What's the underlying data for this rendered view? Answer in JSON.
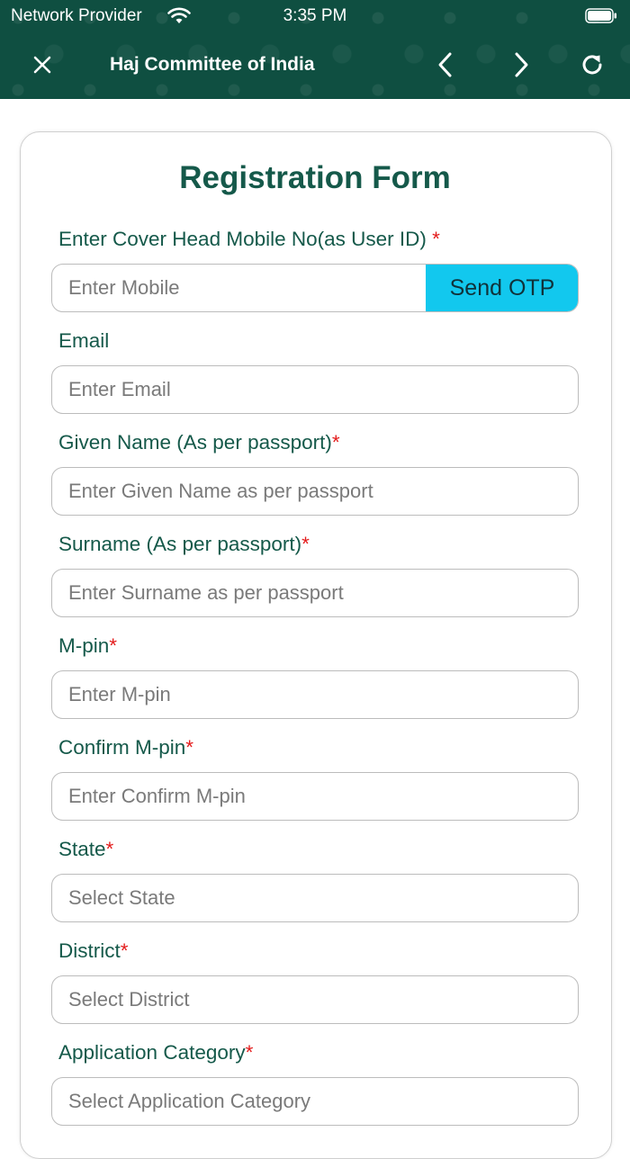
{
  "status_bar": {
    "carrier": "Network Provider",
    "time": "3:35 PM"
  },
  "nav": {
    "title": "Haj Committee of India"
  },
  "form": {
    "title": "Registration Form",
    "required_mark": "*",
    "mobile": {
      "label": "Enter Cover Head Mobile No(as User ID) ",
      "placeholder": "Enter Mobile",
      "otp_label": "Send OTP"
    },
    "email": {
      "label": "Email",
      "placeholder": "Enter Email"
    },
    "given_name": {
      "label": "Given Name (As per passport)",
      "placeholder": "Enter Given Name as per passport"
    },
    "surname": {
      "label": "Surname (As per passport)",
      "placeholder": "Enter Surname as per passport"
    },
    "mpin": {
      "label": "M-pin",
      "placeholder": "Enter M-pin"
    },
    "confirm_mpin": {
      "label": "Confirm M-pin",
      "placeholder": "Enter Confirm M-pin"
    },
    "state": {
      "label": "State",
      "placeholder": "Select State"
    },
    "district": {
      "label": "District",
      "placeholder": "Select District"
    },
    "category": {
      "label": "Application Category",
      "placeholder": "Select Application Category"
    }
  }
}
